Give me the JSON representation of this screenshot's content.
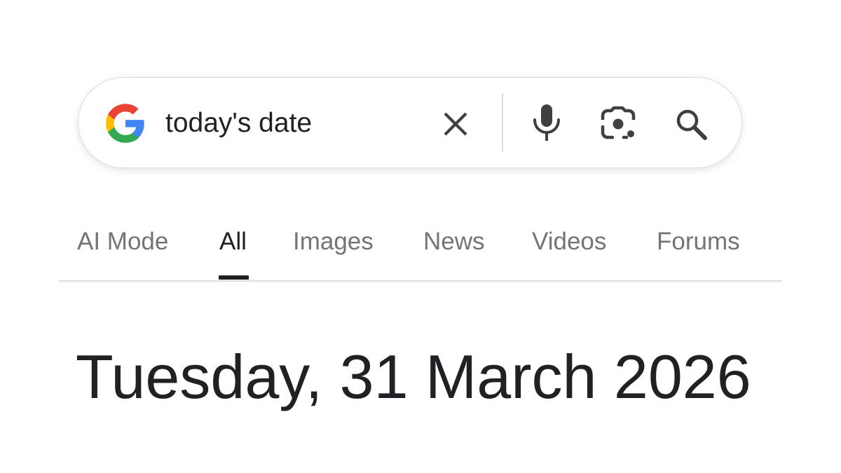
{
  "search": {
    "query": "today's date",
    "icons": [
      "google-g-logo",
      "close-icon",
      "microphone-icon",
      "google-lens-icon",
      "search-icon"
    ]
  },
  "tabs": [
    {
      "label": "AI Mode",
      "active": false
    },
    {
      "label": "All",
      "active": true
    },
    {
      "label": "Images",
      "active": false
    },
    {
      "label": "News",
      "active": false
    },
    {
      "label": "Videos",
      "active": false
    },
    {
      "label": "Forums",
      "active": false
    }
  ],
  "result": {
    "date_text": "Tuesday, 31 March 2026"
  },
  "colors": {
    "text_primary": "#202124",
    "text_secondary": "#70757a",
    "border": "#dadce0",
    "google_blue": "#4285F4",
    "google_red": "#EA4335",
    "google_yellow": "#FBBC05",
    "google_green": "#34A853"
  }
}
